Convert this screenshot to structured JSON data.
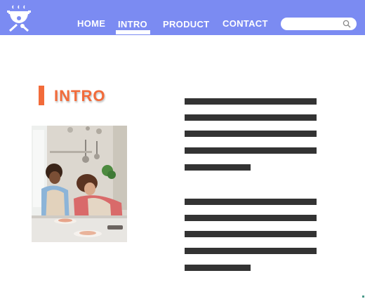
{
  "nav": {
    "home": "HOME",
    "intro": "INTRO",
    "product": "PRODUCT",
    "contact": "CONTACT",
    "active": "intro"
  },
  "search": {
    "value": "",
    "placeholder": ""
  },
  "section": {
    "title": "INTRO"
  },
  "colors": {
    "header_bg": "#7b8bf2",
    "accent": "#f26b3a",
    "text_placeholder": "#333333"
  },
  "icons": [
    "cooking-pot-logo-icon",
    "search-icon"
  ],
  "photo": {
    "subject": "two children cooking in a kitchen"
  }
}
